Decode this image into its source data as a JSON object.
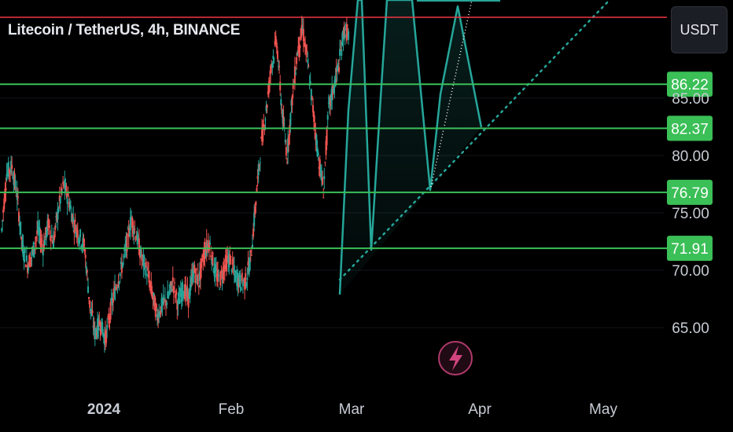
{
  "header": {
    "symbol_title": "Litecoin / TetherUS, 4h, BINANCE",
    "currency_button": "USDT"
  },
  "colors": {
    "background": "#000000",
    "level_line": "#3bbf57",
    "red_line": "#f23645",
    "pattern": "#26a69a",
    "candle_up": "#26a69a",
    "candle_down": "#ef5350",
    "badge_bg": "#3bbf57",
    "icon_ring": "#b03a6b"
  },
  "icons": {
    "lightning": "lightning-icon"
  },
  "chart_data": {
    "type": "candlestick",
    "title": "Litecoin / TetherUS, 4h, BINANCE",
    "y_axis": {
      "ticks": [
        65.0,
        70.0,
        75.0,
        80.0,
        85.0
      ],
      "tick_labels": [
        "65.00",
        "70.00",
        "75.00",
        "80.00",
        "85.00"
      ],
      "ylim": [
        60.5,
        98
      ]
    },
    "x_axis": {
      "tick_labels": [
        "2024",
        "Feb",
        "Mar",
        "Apr",
        "May"
      ]
    },
    "horizontal_levels": [
      {
        "value": 86.22,
        "label": "86.22"
      },
      {
        "value": 82.37,
        "label": "82.37"
      },
      {
        "value": 76.79,
        "label": "76.79"
      },
      {
        "value": 71.91,
        "label": "71.91"
      }
    ],
    "price_series_approx": [
      [
        0,
        73.5
      ],
      [
        0.5,
        78.5
      ],
      [
        1,
        79
      ],
      [
        1.5,
        76.5
      ],
      [
        2,
        72
      ],
      [
        2.5,
        70.5
      ],
      [
        3,
        71.5
      ],
      [
        3.5,
        73.5
      ],
      [
        4,
        72
      ],
      [
        4.5,
        74
      ],
      [
        5,
        72.5
      ],
      [
        5.5,
        75.5
      ],
      [
        6,
        77.5
      ],
      [
        6.5,
        76
      ],
      [
        7,
        74
      ],
      [
        7.5,
        73
      ],
      [
        8,
        72
      ],
      [
        8.5,
        67
      ],
      [
        9,
        64.5
      ],
      [
        9.5,
        65.5
      ],
      [
        10,
        64
      ],
      [
        10.5,
        66.5
      ],
      [
        11,
        68.5
      ],
      [
        11.5,
        70
      ],
      [
        12,
        72
      ],
      [
        12.5,
        74.5
      ],
      [
        13,
        73
      ],
      [
        13.5,
        71
      ],
      [
        14,
        70
      ],
      [
        14.5,
        68
      ],
      [
        15,
        66
      ],
      [
        15.5,
        67
      ],
      [
        16,
        67.5
      ],
      [
        16.5,
        69
      ],
      [
        17,
        67
      ],
      [
        17.5,
        68.5
      ],
      [
        18,
        67.5
      ],
      [
        18.5,
        70
      ],
      [
        19,
        69
      ],
      [
        19.5,
        71.5
      ],
      [
        20,
        72.5
      ],
      [
        20.5,
        70
      ],
      [
        21,
        69
      ],
      [
        21.5,
        70.5
      ],
      [
        22,
        71
      ],
      [
        22.5,
        69.5
      ],
      [
        23,
        69
      ],
      [
        23.5,
        69
      ],
      [
        24,
        71
      ],
      [
        24.5,
        76
      ],
      [
        25,
        81
      ],
      [
        25.5,
        84
      ],
      [
        26,
        88
      ],
      [
        26.5,
        90
      ],
      [
        27,
        84
      ],
      [
        27.5,
        80
      ],
      [
        28,
        85
      ],
      [
        28.5,
        89
      ],
      [
        29,
        91
      ],
      [
        29.5,
        88
      ],
      [
        30,
        84
      ],
      [
        30.5,
        80
      ],
      [
        31,
        77
      ],
      [
        31.5,
        84
      ],
      [
        32,
        86
      ],
      [
        32.5,
        88
      ],
      [
        33,
        91
      ],
      [
        33.5,
        90.5
      ]
    ]
  }
}
